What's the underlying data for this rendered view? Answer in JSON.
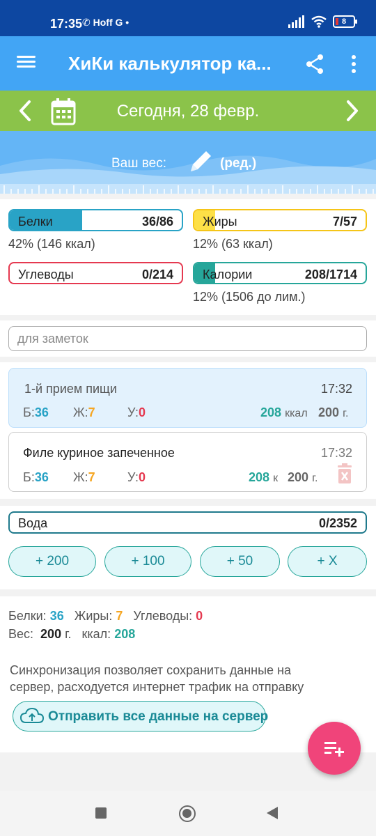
{
  "status_bar": {
    "time": "17:35",
    "notif_icons": "✆ Hoff G •",
    "battery": "8"
  },
  "toolbar": {
    "title": "ХиКи калькулятор ка..."
  },
  "date_bar": {
    "date": "Сегодня, 28 февр."
  },
  "weight": {
    "label": "Ваш вес:",
    "edit": "(ред.)"
  },
  "macros": {
    "protein": {
      "name": "Белки",
      "value": "36/86",
      "progress": 0.42,
      "sub": "42% (146 ккал)",
      "color": "#29a3c6"
    },
    "fat": {
      "name": "Жиры",
      "value": "7/57",
      "progress": 0.12,
      "sub": "12% (63 ккал)",
      "color": "#f5c518"
    },
    "carbs": {
      "name": "Углеводы",
      "value": "0/214",
      "progress": 0.0,
      "sub": "",
      "color": "#e53950"
    },
    "calories": {
      "name": "Калории",
      "value": "208/1714",
      "progress": 0.12,
      "sub": "12% (1506 до лим.)",
      "color": "#26a69a"
    }
  },
  "notes": {
    "placeholder": "для заметок"
  },
  "meal": {
    "name": "1-й прием пищи",
    "time": "17:32",
    "p_label": "Б:",
    "p": "36",
    "f_label": "Ж:",
    "f": "7",
    "c_label": "У:",
    "c": "0",
    "kcal": "208",
    "kcal_unit": "ккал",
    "grams": "200",
    "grams_unit": "г."
  },
  "item": {
    "name": "Филе куриное запеченное",
    "time": "17:32",
    "p_label": "Б:",
    "p": "36",
    "f_label": "Ж:",
    "f": "7",
    "c_label": "У:",
    "c": "0",
    "kcal": "208",
    "kcal_unit": "к",
    "grams": "200",
    "grams_unit": "г."
  },
  "water": {
    "name": "Вода",
    "value": "0/2352",
    "buttons": [
      "+ 200",
      "+ 100",
      "+ 50",
      "+ X"
    ]
  },
  "summary": {
    "protein_label": "Белки:",
    "protein": "36",
    "fat_label": "Жиры:",
    "fat": "7",
    "carbs_label": "Углеводы:",
    "carbs": "0",
    "weight_label": "Вес:",
    "weight": "200",
    "weight_unit": "г.",
    "kcal_label": "ккал:",
    "kcal": "208"
  },
  "sync": {
    "text": "Синхронизация позволяет сохранить данные на сервер, расходуется интернет трафик на отправку",
    "button": "Отправить все данные на сервер"
  },
  "colors": {
    "toolbar": "#42a5f5",
    "date_bar": "#8bc34a",
    "fab": "#f0447a",
    "accent": "#26a69a"
  }
}
